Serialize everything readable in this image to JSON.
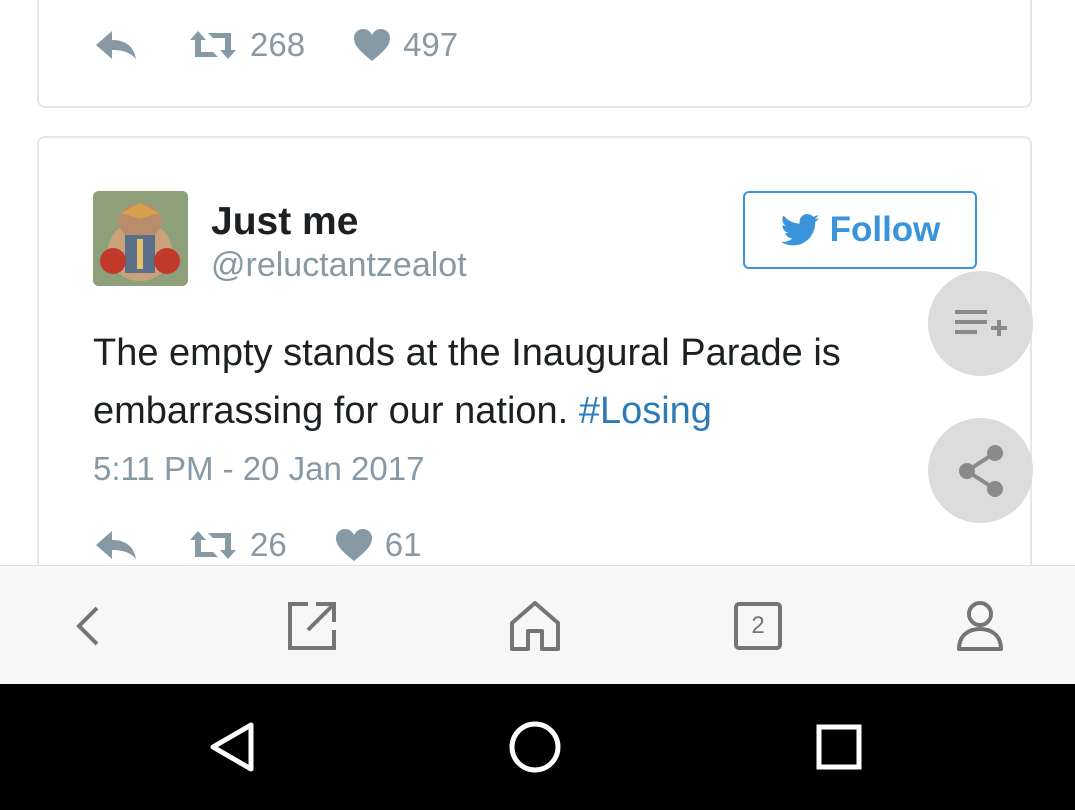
{
  "previous_tweet": {
    "retweet_count": "268",
    "like_count": "497"
  },
  "tweet": {
    "author_name": "Just me",
    "author_handle": "@reluctantzealot",
    "follow_label": "Follow",
    "text": "The empty stands at the Inaugural Parade is embarrassing for our nation. ",
    "hashtag": "#Losing",
    "timestamp": "5:11 PM - 20 Jan 2017",
    "retweet_count": "26",
    "like_count": "61"
  },
  "browser_toolbar": {
    "tab_count": "2"
  },
  "colors": {
    "twitter_blue": "#3b94d9",
    "hashtag_blue": "#2b7bb9",
    "meta_gray": "#8899a6",
    "fab_gray": "#dcdcdc"
  },
  "icons": {
    "action_bar": [
      "reply-icon",
      "retweet-icon",
      "heart-icon"
    ],
    "floating": [
      "playlist-add-icon",
      "share-icon"
    ],
    "browser_toolbar": [
      "back-chevron-icon",
      "open-external-icon",
      "home-icon",
      "tabs-icon",
      "profile-icon"
    ],
    "system_nav": [
      "nav-back-icon",
      "nav-home-icon",
      "nav-recents-icon"
    ]
  }
}
